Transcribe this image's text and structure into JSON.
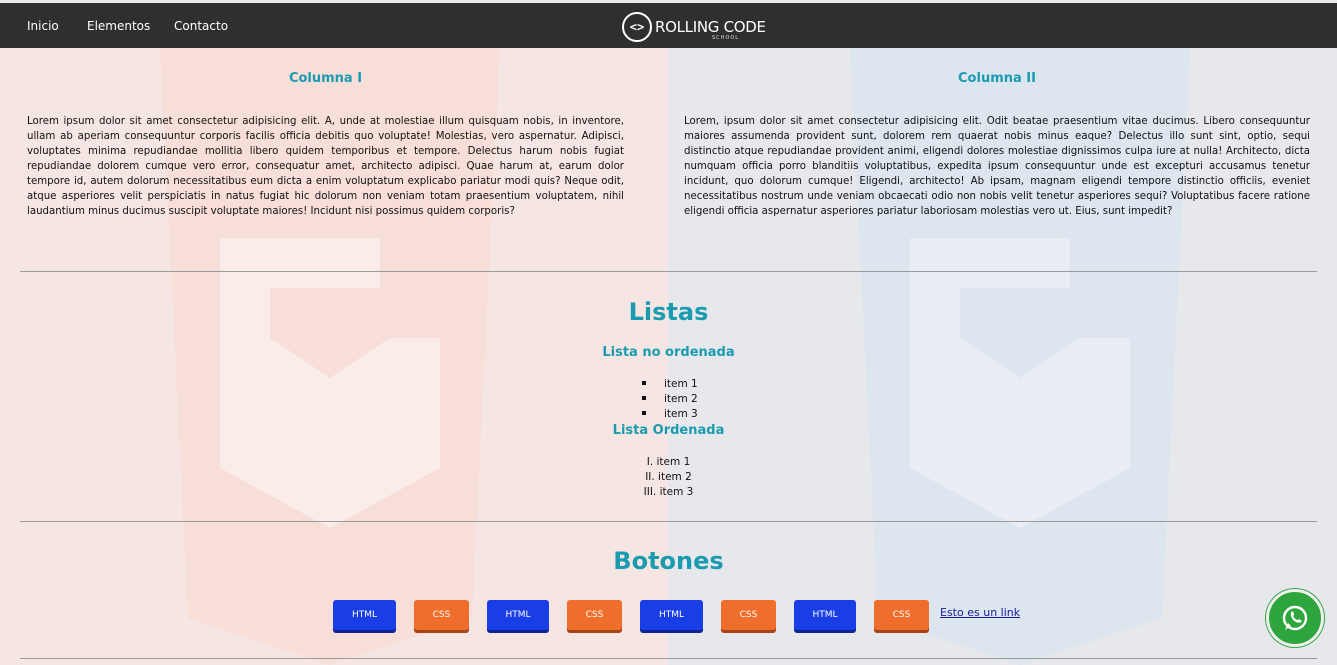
{
  "nav": {
    "items": [
      "Inicio",
      "Elementos",
      "Contacto"
    ],
    "logo_symbol": "<>",
    "logo_text": "ROLLING CODE",
    "logo_sub": "SCHOOL"
  },
  "columns": [
    {
      "title": "Columna I",
      "text": "Lorem ipsum dolor sit amet consectetur adipisicing elit. A, unde at molestiae illum quisquam nobis, in inventore, ullam ab aperiam consequuntur corporis facilis officia debitis quo voluptate! Molestias, vero aspernatur. Adipisci, voluptates minima repudiandae mollitia libero quidem temporibus et tempore. Delectus harum nobis fugiat repudiandae dolorem cumque vero error, consequatur amet, architecto adipisci. Quae harum at, earum dolor tempore id, autem dolorum necessitatibus eum dicta a enim voluptatum explicabo pariatur modi quis? Neque odit, atque asperiores velit perspiciatis in natus fugiat hic dolorum non veniam totam praesentium voluptatem, nihil laudantium minus ducimus suscipit voluptate maiores! Incidunt nisi possimus quidem corporis?"
    },
    {
      "title": "Columna II",
      "text": "Lorem, ipsum dolor sit amet consectetur adipisicing elit. Odit beatae praesentium vitae ducimus. Libero consequuntur maiores assumenda provident sunt, dolorem rem quaerat nobis minus eaque? Delectus illo sunt sint, optio, sequi distinctio atque repudiandae provident animi, eligendi dolores molestiae dignissimos culpa iure at nulla! Architecto, dicta numquam officia porro blanditiis voluptatibus, expedita ipsum consequuntur unde est excepturi accusamus tenetur incidunt, quo dolorum cumque! Eligendi, architecto! Ab ipsam, magnam eligendi tempore distinctio officiis, eveniet necessitatibus nostrum unde veniam obcaecati odio non nobis velit tenetur asperiores sequi? Voluptatibus facere ratione eligendi officia aspernatur asperiores pariatur laboriosam molestias vero ut. Eius, sunt impedit?"
    }
  ],
  "lists": {
    "title": "Listas",
    "unordered_title": "Lista no ordenada",
    "unordered": [
      "item 1",
      "item 2",
      "item 3"
    ],
    "ordered_title": "Lista Ordenada",
    "ordered": [
      "I. item 1",
      "II. item 2",
      "III. item 3"
    ]
  },
  "buttons": {
    "title": "Botones",
    "items": [
      "HTML",
      "CSS",
      "HTML",
      "CSS",
      "HTML",
      "CSS",
      "HTML",
      "CSS"
    ],
    "link": "Esto es un link"
  },
  "colors": {
    "accent": "#1a9bb0",
    "html_button": "#1a3ee6",
    "css_button": "#f06e2c",
    "whatsapp": "#2fa53e"
  },
  "icons": {
    "whatsapp": "whatsapp-icon"
  }
}
